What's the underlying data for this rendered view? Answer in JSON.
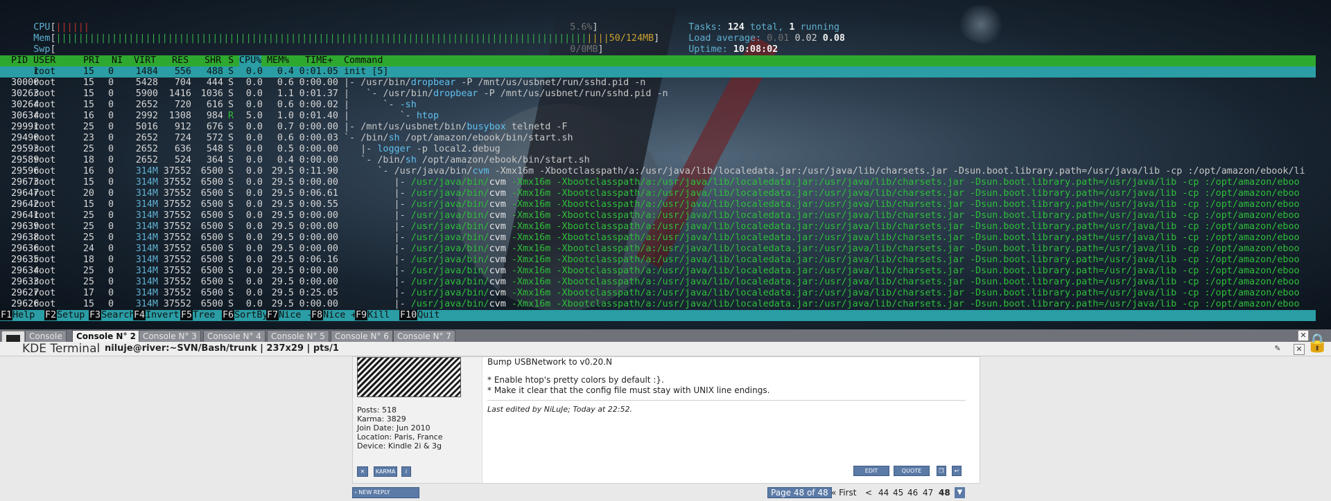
{
  "meters": {
    "cpu": {
      "label": "CPU",
      "value": "5.6%"
    },
    "mem": {
      "label": "Mem",
      "value": "50/124MB"
    },
    "swp": {
      "label": "Swp",
      "value": "0/0MB"
    }
  },
  "stats": {
    "tasks_label": "Tasks:",
    "tasks_total": "124",
    "tasks_mid": " total, ",
    "tasks_running": "1",
    "tasks_end": " running",
    "load_label": "Load average:",
    "load1": "0.01",
    "load5": "0.02",
    "load15": "0.08",
    "uptime_label": "Uptime:",
    "uptime": "10:08:02"
  },
  "columns": [
    "PID",
    "USER",
    "PRI",
    "NI",
    "VIRT",
    "RES",
    "SHR",
    "S",
    "CPU%",
    "MEM%",
    "TIME+",
    "Command"
  ],
  "processes": [
    {
      "pid": "1",
      "user": "root",
      "pri": "15",
      "ni": "0",
      "virt": "1484",
      "res": "556",
      "shr": "488",
      "s": "S",
      "cpu": "0.0",
      "mem": "0.4",
      "time": "0:01.05",
      "tree": "",
      "cmd": [
        {
          "t": "init [5]",
          "c": "d"
        }
      ]
    },
    {
      "pid": "30000",
      "user": "root",
      "pri": "15",
      "ni": "0",
      "virt": "5428",
      "res": "704",
      "shr": "444",
      "s": "S",
      "cpu": "0.0",
      "mem": "0.6",
      "time": "0:00.00",
      "tree": "|- ",
      "cmd": [
        {
          "t": "/usr/bin/",
          "c": "d"
        },
        {
          "t": "dropbear",
          "c": "b"
        },
        {
          "t": " -P /mnt/us/usbnet/run/sshd.pid -n",
          "c": "d"
        }
      ]
    },
    {
      "pid": "30263",
      "user": "root",
      "pri": "15",
      "ni": "0",
      "virt": "5900",
      "res": "1416",
      "shr": "1036",
      "s": "S",
      "cpu": "0.0",
      "mem": "1.1",
      "time": "0:01.37",
      "tree": "|   `- ",
      "cmd": [
        {
          "t": "/usr/bin/",
          "c": "d"
        },
        {
          "t": "dropbear",
          "c": "b"
        },
        {
          "t": " -P /mnt/us/usbnet/run/sshd.pid -n",
          "c": "d"
        }
      ]
    },
    {
      "pid": "30264",
      "user": "root",
      "pri": "15",
      "ni": "0",
      "virt": "2652",
      "res": "720",
      "shr": "616",
      "s": "S",
      "cpu": "0.0",
      "mem": "0.6",
      "time": "0:00.02",
      "tree": "|      `- ",
      "cmd": [
        {
          "t": "-sh",
          "c": "b"
        }
      ]
    },
    {
      "pid": "30634",
      "user": "root",
      "pri": "16",
      "ni": "0",
      "virt": "2992",
      "res": "1308",
      "shr": "984",
      "s": "R",
      "cpu": "5.0",
      "mem": "1.0",
      "time": "0:01.40",
      "tree": "|         `- ",
      "cmd": [
        {
          "t": "htop",
          "c": "b"
        }
      ]
    },
    {
      "pid": "29991",
      "user": "root",
      "pri": "25",
      "ni": "0",
      "virt": "5016",
      "res": "912",
      "shr": "676",
      "s": "S",
      "cpu": "0.0",
      "mem": "0.7",
      "time": "0:00.00",
      "tree": "|- ",
      "cmd": [
        {
          "t": "/mnt/us/usbnet/bin/",
          "c": "d"
        },
        {
          "t": "busybox",
          "c": "b"
        },
        {
          "t": " telnetd -F",
          "c": "d"
        }
      ]
    },
    {
      "pid": "29490",
      "user": "root",
      "pri": "23",
      "ni": "0",
      "virt": "2652",
      "res": "724",
      "shr": "572",
      "s": "S",
      "cpu": "0.0",
      "mem": "0.6",
      "time": "0:00.03",
      "tree": "`- ",
      "cmd": [
        {
          "t": "/bin/",
          "c": "d"
        },
        {
          "t": "sh",
          "c": "b"
        },
        {
          "t": " /opt/amazon/ebook/bin/start.sh",
          "c": "d"
        }
      ]
    },
    {
      "pid": "29593",
      "user": "root",
      "pri": "25",
      "ni": "0",
      "virt": "2652",
      "res": "636",
      "shr": "548",
      "s": "S",
      "cpu": "0.0",
      "mem": "0.5",
      "time": "0:00.00",
      "tree": "   |- ",
      "cmd": [
        {
          "t": "logger",
          "c": "b"
        },
        {
          "t": " -p local2.debug",
          "c": "d"
        }
      ]
    },
    {
      "pid": "29589",
      "user": "root",
      "pri": "18",
      "ni": "0",
      "virt": "2652",
      "res": "524",
      "shr": "364",
      "s": "S",
      "cpu": "0.0",
      "mem": "0.4",
      "time": "0:00.00",
      "tree": "   `- ",
      "cmd": [
        {
          "t": "/bin/",
          "c": "d"
        },
        {
          "t": "sh",
          "c": "b"
        },
        {
          "t": " /opt/amazon/ebook/bin/start.sh",
          "c": "d"
        }
      ]
    },
    {
      "pid": "29596",
      "user": "root",
      "pri": "16",
      "ni": "0",
      "virt": "314M",
      "res": "37552",
      "shr": "6500",
      "s": "S",
      "cpu": "0.0",
      "mem": "29.5",
      "time": "0:11.90",
      "tree": "      `- ",
      "cmd": [
        {
          "t": "/usr/java/bin/",
          "c": "d"
        },
        {
          "t": "cvm",
          "c": "b"
        },
        {
          "t": " -Xmx16m -Xbootclasspath/a:/usr/java/lib/localedata.jar:/usr/java/lib/charsets.jar -Dsun.boot.library.path=/usr/java/lib -cp :/opt/amazon/ebook/li",
          "c": "d"
        }
      ]
    },
    {
      "pid": "29673",
      "user": "root",
      "pri": "15",
      "ni": "0",
      "virt": "314M",
      "res": "37552",
      "shr": "6500",
      "s": "S",
      "cpu": "0.0",
      "mem": "29.5",
      "time": "0:00.00",
      "tree": "         |- ",
      "cmd": [
        {
          "t": "/usr/java/bin/",
          "c": "g"
        },
        {
          "t": "cvm",
          "c": "gb"
        },
        {
          "t": " -Xmx16m -Xbootclasspath/a:/usr/java/lib/localedata.jar:/usr/java/lib/charsets.jar -Dsun.boot.library.path=/usr/java/lib -cp :/opt/amazon/eboo",
          "c": "g"
        }
      ]
    },
    {
      "pid": "29647",
      "user": "root",
      "pri": "20",
      "ni": "0",
      "virt": "314M",
      "res": "37552",
      "shr": "6500",
      "s": "S",
      "cpu": "0.0",
      "mem": "29.5",
      "time": "0:06.61",
      "tree": "         |- ",
      "cmd": [
        {
          "t": "/usr/java/bin/",
          "c": "g"
        },
        {
          "t": "cvm",
          "c": "gb"
        },
        {
          "t": " -Xmx16m -Xbootclasspath/a:/usr/java/lib/localedata.jar:/usr/java/lib/charsets.jar -Dsun.boot.library.path=/usr/java/lib -cp :/opt/amazon/eboo",
          "c": "g"
        }
      ]
    },
    {
      "pid": "29642",
      "user": "root",
      "pri": "15",
      "ni": "0",
      "virt": "314M",
      "res": "37552",
      "shr": "6500",
      "s": "S",
      "cpu": "0.0",
      "mem": "29.5",
      "time": "0:00.55",
      "tree": "         |- ",
      "cmd": [
        {
          "t": "/usr/java/bin/",
          "c": "g"
        },
        {
          "t": "cvm",
          "c": "gb"
        },
        {
          "t": " -Xmx16m -Xbootclasspath/a:/usr/java/lib/localedata.jar:/usr/java/lib/charsets.jar -Dsun.boot.library.path=/usr/java/lib -cp :/opt/amazon/eboo",
          "c": "g"
        }
      ]
    },
    {
      "pid": "29641",
      "user": "root",
      "pri": "25",
      "ni": "0",
      "virt": "314M",
      "res": "37552",
      "shr": "6500",
      "s": "S",
      "cpu": "0.0",
      "mem": "29.5",
      "time": "0:00.00",
      "tree": "         |- ",
      "cmd": [
        {
          "t": "/usr/java/bin/",
          "c": "g"
        },
        {
          "t": "cvm",
          "c": "gb"
        },
        {
          "t": " -Xmx16m -Xbootclasspath/a:/usr/java/lib/localedata.jar:/usr/java/lib/charsets.jar -Dsun.boot.library.path=/usr/java/lib -cp :/opt/amazon/eboo",
          "c": "g"
        }
      ]
    },
    {
      "pid": "29639",
      "user": "root",
      "pri": "25",
      "ni": "0",
      "virt": "314M",
      "res": "37552",
      "shr": "6500",
      "s": "S",
      "cpu": "0.0",
      "mem": "29.5",
      "time": "0:00.00",
      "tree": "         |- ",
      "cmd": [
        {
          "t": "/usr/java/bin/",
          "c": "g"
        },
        {
          "t": "cvm",
          "c": "gb"
        },
        {
          "t": " -Xmx16m -Xbootclasspath/a:/usr/java/lib/localedata.jar:/usr/java/lib/charsets.jar -Dsun.boot.library.path=/usr/java/lib -cp :/opt/amazon/eboo",
          "c": "g"
        }
      ]
    },
    {
      "pid": "29638",
      "user": "root",
      "pri": "25",
      "ni": "0",
      "virt": "314M",
      "res": "37552",
      "shr": "6500",
      "s": "S",
      "cpu": "0.0",
      "mem": "29.5",
      "time": "0:00.00",
      "tree": "         |- ",
      "cmd": [
        {
          "t": "/usr/java/bin/",
          "c": "g"
        },
        {
          "t": "cvm",
          "c": "gb"
        },
        {
          "t": " -Xmx16m -Xbootclasspath/a:/usr/java/lib/localedata.jar:/usr/java/lib/charsets.jar -Dsun.boot.library.path=/usr/java/lib -cp :/opt/amazon/eboo",
          "c": "g"
        }
      ]
    },
    {
      "pid": "29636",
      "user": "root",
      "pri": "24",
      "ni": "0",
      "virt": "314M",
      "res": "37552",
      "shr": "6500",
      "s": "S",
      "cpu": "0.0",
      "mem": "29.5",
      "time": "0:00.00",
      "tree": "         |- ",
      "cmd": [
        {
          "t": "/usr/java/bin/",
          "c": "g"
        },
        {
          "t": "cvm",
          "c": "gb"
        },
        {
          "t": " -Xmx16m -Xbootclasspath/a:/usr/java/lib/localedata.jar:/usr/java/lib/charsets.jar -Dsun.boot.library.path=/usr/java/lib -cp :/opt/amazon/eboo",
          "c": "g"
        }
      ]
    },
    {
      "pid": "29635",
      "user": "root",
      "pri": "18",
      "ni": "0",
      "virt": "314M",
      "res": "37552",
      "shr": "6500",
      "s": "S",
      "cpu": "0.0",
      "mem": "29.5",
      "time": "0:06.16",
      "tree": "         |- ",
      "cmd": [
        {
          "t": "/usr/java/bin/",
          "c": "g"
        },
        {
          "t": "cvm",
          "c": "gb"
        },
        {
          "t": " -Xmx16m -Xbootclasspath/a:/usr/java/lib/localedata.jar:/usr/java/lib/charsets.jar -Dsun.boot.library.path=/usr/java/lib -cp :/opt/amazon/eboo",
          "c": "g"
        }
      ]
    },
    {
      "pid": "29634",
      "user": "root",
      "pri": "25",
      "ni": "0",
      "virt": "314M",
      "res": "37552",
      "shr": "6500",
      "s": "S",
      "cpu": "0.0",
      "mem": "29.5",
      "time": "0:00.00",
      "tree": "         |- ",
      "cmd": [
        {
          "t": "/usr/java/bin/",
          "c": "g"
        },
        {
          "t": "cvm",
          "c": "gb"
        },
        {
          "t": " -Xmx16m -Xbootclasspath/a:/usr/java/lib/localedata.jar:/usr/java/lib/charsets.jar -Dsun.boot.library.path=/usr/java/lib -cp :/opt/amazon/eboo",
          "c": "g"
        }
      ]
    },
    {
      "pid": "29633",
      "user": "root",
      "pri": "25",
      "ni": "0",
      "virt": "314M",
      "res": "37552",
      "shr": "6500",
      "s": "S",
      "cpu": "0.0",
      "mem": "29.5",
      "time": "0:00.00",
      "tree": "         |- ",
      "cmd": [
        {
          "t": "/usr/java/bin/",
          "c": "g"
        },
        {
          "t": "cvm",
          "c": "gb"
        },
        {
          "t": " -Xmx16m -Xbootclasspath/a:/usr/java/lib/localedata.jar:/usr/java/lib/charsets.jar -Dsun.boot.library.path=/usr/java/lib -cp :/opt/amazon/eboo",
          "c": "g"
        }
      ]
    },
    {
      "pid": "29627",
      "user": "root",
      "pri": "17",
      "ni": "0",
      "virt": "314M",
      "res": "37552",
      "shr": "6500",
      "s": "S",
      "cpu": "0.0",
      "mem": "29.5",
      "time": "0:25.05",
      "tree": "         |- ",
      "cmd": [
        {
          "t": "/usr/java/bin/",
          "c": "g"
        },
        {
          "t": "cvm",
          "c": "gb"
        },
        {
          "t": " -Xmx16m -Xbootclasspath/a:/usr/java/lib/localedata.jar:/usr/java/lib/charsets.jar -Dsun.boot.library.path=/usr/java/lib -cp :/opt/amazon/eboo",
          "c": "g"
        }
      ]
    },
    {
      "pid": "29626",
      "user": "root",
      "pri": "15",
      "ni": "0",
      "virt": "314M",
      "res": "37552",
      "shr": "6500",
      "s": "S",
      "cpu": "0.0",
      "mem": "29.5",
      "time": "0:00.00",
      "tree": "         |- ",
      "cmd": [
        {
          "t": "/usr/java/bin/",
          "c": "g"
        },
        {
          "t": "cvm",
          "c": "gb"
        },
        {
          "t": " -Xmx16m -Xbootclasspath/a:/usr/java/lib/localedata.jar:/usr/java/lib/charsets.jar -Dsun.boot.library.path=/usr/java/lib -cp :/opt/amazon/eboo",
          "c": "g"
        }
      ]
    }
  ],
  "fkeys": [
    {
      "key": "F1",
      "label": "Help"
    },
    {
      "key": "F2",
      "label": "Setup"
    },
    {
      "key": "F3",
      "label": "Search"
    },
    {
      "key": "F4",
      "label": "Invert"
    },
    {
      "key": "F5",
      "label": "Tree"
    },
    {
      "key": "F6",
      "label": "SortBy"
    },
    {
      "key": "F7",
      "label": "Nice -"
    },
    {
      "key": "F8",
      "label": "Nice +"
    },
    {
      "key": "F9",
      "label": "Kill"
    },
    {
      "key": "F10",
      "label": "Quit"
    }
  ],
  "konsole": {
    "tabs": [
      "Console",
      "Console N° 2",
      "Console N° 3",
      "Console N° 4",
      "Console N° 5",
      "Console N° 6",
      "Console N° 7"
    ],
    "app_name": "KDE Terminal",
    "title": "niluje@river:~SVN/Bash/trunk | 237x29 | pts/1"
  },
  "forum": {
    "message_line1": "Bump USBNetwork to v0.20.N",
    "message_line2": "* Enable htop's pretty colors by default :}.",
    "message_line3": "* Make it clear that the config file must stay with UNIX line endings.",
    "edited_prefix": "Last edited by ",
    "edited_user": "NiLuJe",
    "edited_suffix": "; Today at 22:52.",
    "posts": "Posts: 518",
    "karma": "Karma: 3829",
    "join_date": "Join Date: Jun 2010",
    "location": "Location: Paris, France",
    "device": "Device: Kindle 2i & 3g",
    "karma_btn": "KARMA",
    "edit_btn": "EDIT",
    "quote_btn": "QUOTE",
    "reply_btn": "NEW REPLY",
    "page_of": "Page 48 of 48",
    "first": "« First",
    "prev": "<",
    "pages": [
      "44",
      "45",
      "46",
      "47",
      "48"
    ]
  }
}
